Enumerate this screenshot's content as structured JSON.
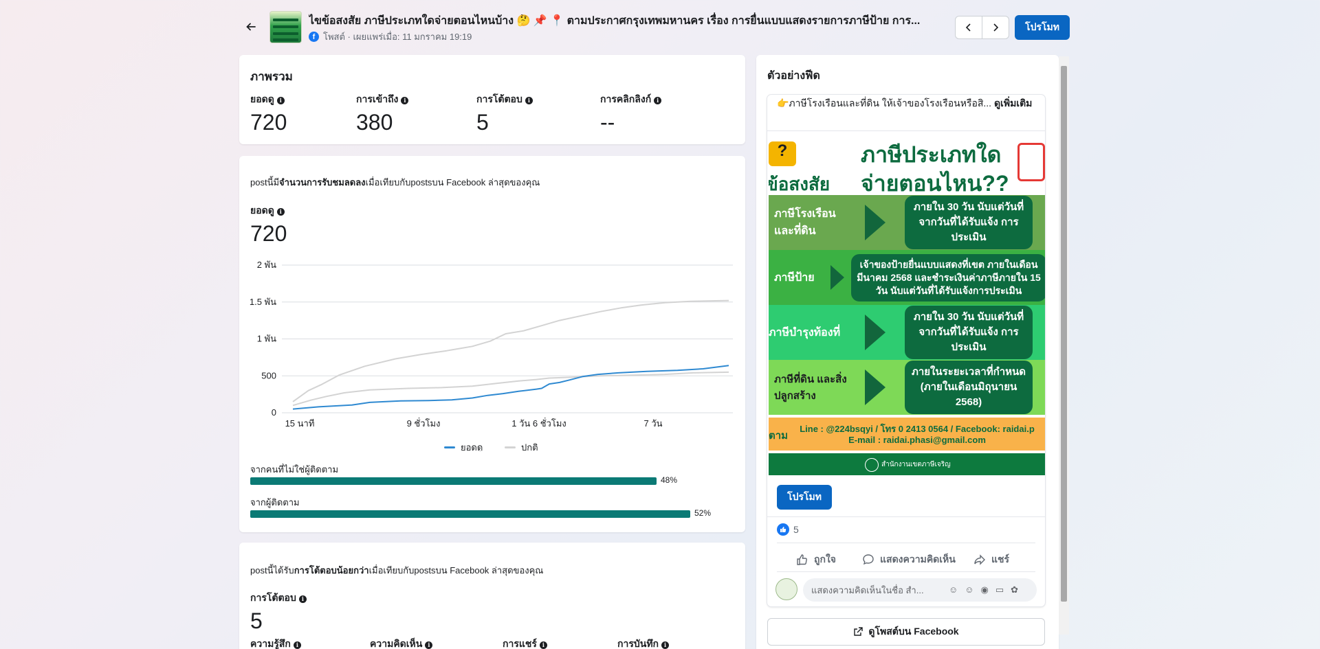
{
  "header": {
    "post_title": "ไขข้อสงสัย ภาษีประเภทใดจ่ายตอนไหนบ้าง 🤔 📌 📍 ตามประกาศกรุงเทพมหานคร เรื่อง การยื่นแบบแสดงรายการภาษีป้าย การ...",
    "post_meta": "โพสต์ · เผยแพร่เมื่อ: 11 มกราคม 19:19",
    "promote_label": "โปรโมท"
  },
  "overview": {
    "title": "ภาพรวม",
    "metrics": [
      {
        "label": "ยอดดู",
        "value": "720"
      },
      {
        "label": "การเข้าถึง",
        "value": "380"
      },
      {
        "label": "การโต้ตอบ",
        "value": "5"
      },
      {
        "label": "การคลิกลิงก์",
        "value": "--"
      }
    ]
  },
  "views_card": {
    "summary_prefix": "postนี้มี",
    "summary_bold": "จำนวนการรับชมลดลง",
    "summary_suffix": "เมื่อเทียบกับpostsบน Facebook ล่าสุดของคุณ",
    "metric_label": "ยอดดู",
    "metric_value": "720",
    "legend": [
      {
        "name": "ยอดดู",
        "color": "#2e89d1"
      },
      {
        "name": "ปกติ",
        "color": "#d3d3d3"
      }
    ],
    "audience": [
      {
        "label": "จากคนที่ไม่ใช่ผู้ติดตาม",
        "percent": 48,
        "percent_label": "48%"
      },
      {
        "label": "จากผู้ติดตาม",
        "percent": 52,
        "percent_label": "52%"
      }
    ]
  },
  "chart_data": {
    "type": "line",
    "y_ticks": [
      "2 พัน",
      "1.5 พัน",
      "1 พัน",
      "500",
      "0"
    ],
    "y_tick_values": [
      2000,
      1500,
      1000,
      500,
      0
    ],
    "x_ticks": [
      "15 นาที",
      "9 ชั่วโมง",
      "1 วัน 6 ชั่วโมง",
      "7 วัน"
    ],
    "x_tick_values": [
      0.8,
      9,
      30,
      168
    ],
    "ylim": [
      0,
      2000
    ],
    "grid": true,
    "legend_position": "bottom-center",
    "series": [
      {
        "name": "ยอดดู",
        "color": "#2e89d1",
        "points": [
          [
            0,
            50
          ],
          [
            0.1,
            80
          ],
          [
            0.23,
            105
          ],
          [
            0.3,
            140
          ],
          [
            0.42,
            160
          ],
          [
            0.53,
            165
          ],
          [
            0.62,
            175
          ],
          [
            0.7,
            200
          ],
          [
            0.76,
            235
          ],
          [
            0.82,
            260
          ],
          [
            0.88,
            290
          ],
          [
            0.95,
            320
          ],
          [
            0.97,
            330
          ],
          [
            1.0,
            390
          ],
          [
            1.04,
            410
          ],
          [
            1.08,
            445
          ],
          [
            1.13,
            490
          ],
          [
            1.19,
            520
          ],
          [
            1.27,
            540
          ],
          [
            1.38,
            560
          ],
          [
            1.5,
            575
          ],
          [
            1.6,
            595
          ],
          [
            1.7,
            640
          ]
        ]
      },
      {
        "name": "ปกติ",
        "color": "#d3d3d3",
        "points": [
          [
            0,
            100
          ],
          [
            0.07,
            170
          ],
          [
            0.13,
            220
          ],
          [
            0.2,
            270
          ],
          [
            0.3,
            310
          ],
          [
            0.45,
            330
          ],
          [
            0.58,
            340
          ],
          [
            0.7,
            360
          ],
          [
            0.8,
            400
          ],
          [
            0.88,
            430
          ],
          [
            0.95,
            450
          ],
          [
            1.0,
            470
          ],
          [
            1.08,
            480
          ],
          [
            1.2,
            500
          ],
          [
            1.33,
            510
          ],
          [
            1.45,
            520
          ],
          [
            1.56,
            540
          ],
          [
            1.7,
            550
          ]
        ]
      },
      {
        "name": "ปกติ-บน",
        "color": "#d3d3d3",
        "points": [
          [
            0,
            150
          ],
          [
            0.06,
            300
          ],
          [
            0.11,
            380
          ],
          [
            0.18,
            510
          ],
          [
            0.28,
            630
          ],
          [
            0.4,
            730
          ],
          [
            0.5,
            790
          ],
          [
            0.6,
            840
          ],
          [
            0.7,
            900
          ],
          [
            0.77,
            970
          ],
          [
            0.83,
            1070
          ],
          [
            0.9,
            1110
          ],
          [
            0.97,
            1180
          ],
          [
            1.04,
            1250
          ],
          [
            1.12,
            1310
          ],
          [
            1.2,
            1370
          ],
          [
            1.28,
            1420
          ],
          [
            1.36,
            1460
          ],
          [
            1.45,
            1490
          ],
          [
            1.55,
            1510
          ],
          [
            1.7,
            1520
          ]
        ]
      }
    ]
  },
  "engagement_card": {
    "summary_prefix": "postนี้ได้รับ",
    "summary_bold": "การโต้ตอบน้อยกว่า",
    "summary_suffix": "เมื่อเทียบกับpostsบน Facebook ล่าสุดของคุณ",
    "metric_label": "การโต้ตอบ",
    "metric_value": "5",
    "sub_metrics": [
      "ความรู้สึก",
      "ความคิดเห็น",
      "การแชร์",
      "การบันทึก"
    ]
  },
  "feed_preview": {
    "title": "ตัวอย่างฟีด",
    "caption": "👉ภาษีโรงเรือนและที่ดิน ให้เจ้าของโรงเรือนหรือสิ...",
    "see_more": "ดูเพิ่มเติม",
    "poster": {
      "head_left": "ข้อสงสัย",
      "head_main_1": "ภาษีประเภทใด",
      "head_main_2": "จ่ายตอนไหน??",
      "rows": [
        {
          "left": "ภาษีโรงเรือน และที่ดิน",
          "right": "ภายใน 30 วัน นับแต่วันที่ จากวันที่ได้รับแจ้ง การประเมิน"
        },
        {
          "left": "ภาษีป้าย",
          "right": "เจ้าของป้ายยื่นแบบแสดงที่เขต ภายในเดือน มีนาคม 2568 และชำระเงินค่าภาษีภายใน 15 วัน นับแต่วันที่ได้รับแจ้งการประเมิน"
        },
        {
          "left": "ภาษีบำรุงท้องที่",
          "right": "ภายใน 30 วัน นับแต่วันที่ จากวันที่ได้รับแจ้ง การประเมิน"
        },
        {
          "left": "ภาษีที่ดิน และสิ่งปลูกสร้าง",
          "right": "ภายในระยะเวลาที่กำหนด (ภายในเดือนมิถุนายน 2568)"
        }
      ],
      "contact_left": "ตาม",
      "contact_line1": "Line : @224bsqyi / โทร 0 2413 0564 / Facebook: raidai.p",
      "contact_line2": "E-mail : raidai.phasi@gmail.com",
      "office": "สำนักงานเขตภาษีเจริญ"
    },
    "promote_label": "โปรโมท",
    "reaction_count": "5",
    "actions": [
      "ถูกใจ",
      "แสดงความคิดเห็น",
      "แชร์"
    ],
    "comment_placeholder": "แสดงความคิดเห็นในชื่อ สำ...",
    "view_on_fb": "ดูโพสต์บน Facebook"
  }
}
